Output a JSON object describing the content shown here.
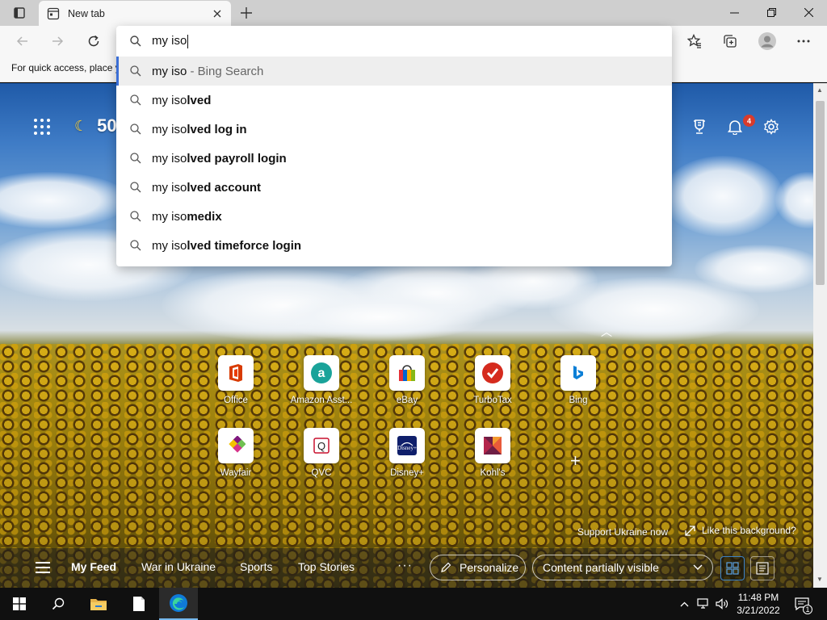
{
  "browser": {
    "tab_title": "New tab",
    "favorites_message": "For quick access, place y",
    "address": {
      "typed_text": "my iso"
    },
    "suggestions": [
      {
        "prefix": "my iso",
        "suffix": "",
        "muted": " - Bing Search",
        "highlighted": true
      },
      {
        "prefix": "my iso",
        "suffix": "lved",
        "muted": "",
        "highlighted": false
      },
      {
        "prefix": "my iso",
        "suffix": "lved log in",
        "muted": "",
        "highlighted": false
      },
      {
        "prefix": "my iso",
        "suffix": "lved payroll login",
        "muted": "",
        "highlighted": false
      },
      {
        "prefix": "my iso",
        "suffix": "lved account",
        "muted": "",
        "highlighted": false
      },
      {
        "prefix": "my iso",
        "suffix": "medix",
        "muted": "",
        "highlighted": false
      },
      {
        "prefix": "my iso",
        "suffix": "lved timeforce login",
        "muted": "",
        "highlighted": false
      }
    ]
  },
  "newtab": {
    "weather_temp": "50",
    "notification_count": "4",
    "quick_links_row1": [
      {
        "label": "Office",
        "icon": "office-icon",
        "color": "#d83b01"
      },
      {
        "label": "Amazon Asst...",
        "icon": "amazon-assistant-icon",
        "color": "#1aa39a"
      },
      {
        "label": "eBay",
        "icon": "ebay-icon",
        "color": "#e53238"
      },
      {
        "label": "TurboTax",
        "icon": "turbotax-icon",
        "color": "#d52b1e"
      },
      {
        "label": "Bing",
        "icon": "bing-icon",
        "color": "#0c7fd6"
      }
    ],
    "quick_links_row2": [
      {
        "label": "Wayfair",
        "icon": "wayfair-icon",
        "color": "#7f187f"
      },
      {
        "label": "QVC",
        "icon": "qvc-icon",
        "color": "#c8102e"
      },
      {
        "label": "Disney+",
        "icon": "disney-plus-icon",
        "color": "#0f1f6b"
      },
      {
        "label": "Kohl's",
        "icon": "kohls-icon",
        "color": "#6e1e45"
      }
    ],
    "support_link": "Support Ukraine now",
    "like_background": "Like this background?",
    "feed": {
      "items": [
        "My Feed",
        "War in Ukraine",
        "Sports",
        "Top Stories"
      ],
      "more": "···",
      "personalize": "Personalize",
      "content_visibility": "Content partially visible"
    }
  },
  "taskbar": {
    "time": "11:48 PM",
    "date": "3/21/2022",
    "notification_count": "1"
  },
  "colors": {
    "accent": "#3b6fd6",
    "edge_blue": "#0f7ad8",
    "badge_red": "#d83b2c"
  }
}
